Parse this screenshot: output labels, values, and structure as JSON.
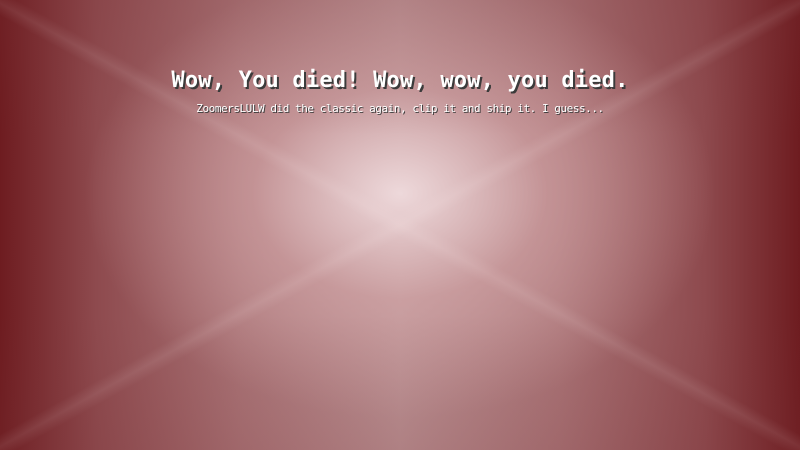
{
  "death_screen": {
    "title": "Wow, You died! Wow, wow, you died.",
    "message": "ZoomersLULW did the classic again, clip it and ship it. I guess..."
  },
  "colors": {
    "edge": "#6e1c20",
    "center_glow": "#f0dcde",
    "text": "#ffffff",
    "text_shadow": "#3b3b3b"
  }
}
